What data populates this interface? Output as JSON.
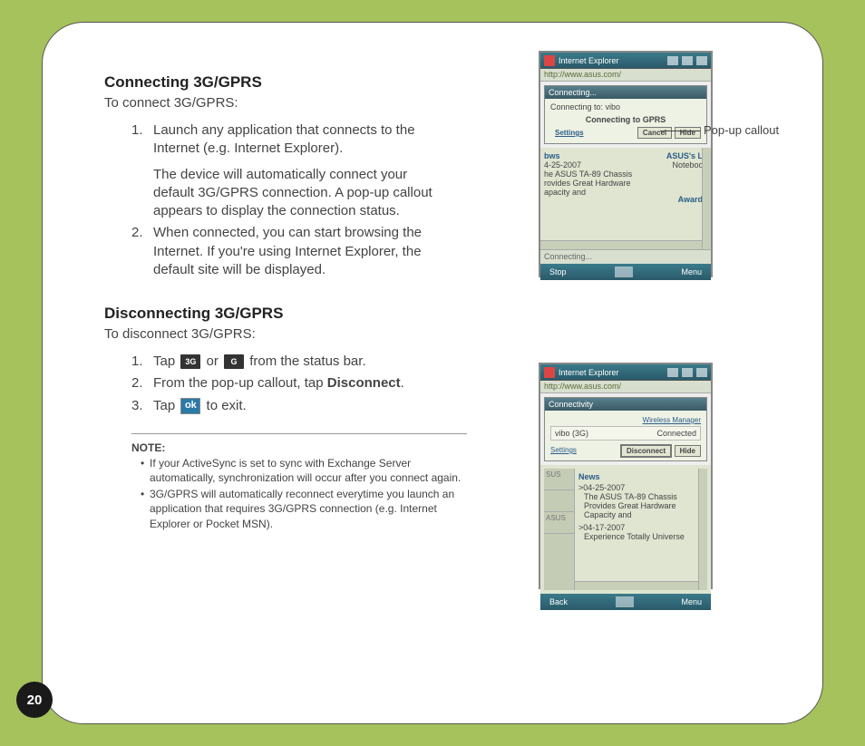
{
  "page_number": "20",
  "section1": {
    "heading": "Connecting 3G/GPRS",
    "intro": "To connect 3G/GPRS:",
    "steps": [
      {
        "num": "1.",
        "text": "Launch any application that connects to the Internet (e.g. Internet Explorer).",
        "sub": "The device will automatically connect your default 3G/GPRS connection. A pop-up callout appears to display the connection status."
      },
      {
        "num": "2.",
        "text": "When connected, you can start browsing the Internet. If you're using Internet Explorer, the default site will be displayed."
      }
    ]
  },
  "section2": {
    "heading": "Disconnecting 3G/GPRS",
    "intro": "To disconnect 3G/GPRS:",
    "step1_num": "1.",
    "step1_pre": "Tap ",
    "step1_or": " or ",
    "step1_post": " from the status bar.",
    "step2_num": "2.",
    "step2_pre": "From the pop-up callout, tap ",
    "step2_bold": "Disconnect",
    "step2_post": ".",
    "step3_num": "3.",
    "step3_pre": "Tap ",
    "step3_post": " to exit.",
    "icon_3g": "3G",
    "icon_g": "G",
    "icon_ok": "ok"
  },
  "note": {
    "title": "NOTE:",
    "bullets": [
      "If your ActiveSync is set to sync with Exchange Server automatically, synchronization will occur after you connect again.",
      "3G/GPRS will automatically reconnect everytime you launch an application that requires 3G/GPRS connection (e.g. Internet Explorer or Pocket MSN)."
    ]
  },
  "callout_label": "Pop-up callout",
  "device1": {
    "title": "Internet Explorer",
    "addr": "http://www.asus.com/",
    "callout_hdr": "Connecting...",
    "callout_line1": "Connecting to: vibo",
    "callout_big": "Connecting to GPRS",
    "btn_settings": "Settings",
    "btn_cancel": "Cancel",
    "btn_hide": "Hide",
    "content_l1": "bws",
    "content_l2": "4-25-2007",
    "content_l3": "he ASUS TA-89 Chassis rovides Great Hardware apacity and",
    "content_r1": "ASUS's La",
    "content_r2": "Notebook",
    "content_r3": "Awards",
    "status": "Connecting...",
    "soft_left": "Stop",
    "soft_right": "Menu"
  },
  "device2": {
    "title": "Internet Explorer",
    "addr": "http://www.asus.com/",
    "callout_hdr": "Connectivity",
    "wireless": "Wireless Manager",
    "conn_name": "vibo (3G)",
    "conn_state": "Connected",
    "settings": "Settings",
    "btn_disc": "Disconnect",
    "btn_hide": "Hide",
    "side1": "SUS",
    "side2": "",
    "side3": "ASUS",
    "news_title": "News",
    "news_d1": ">04-25-2007",
    "news_t1": "The ASUS TA-89 Chassis Provides Great Hardware Capacity and",
    "news_d2": ">04-17-2007",
    "news_t2": "Experience Totally Universe",
    "soft_left": "Back",
    "soft_right": "Menu"
  }
}
